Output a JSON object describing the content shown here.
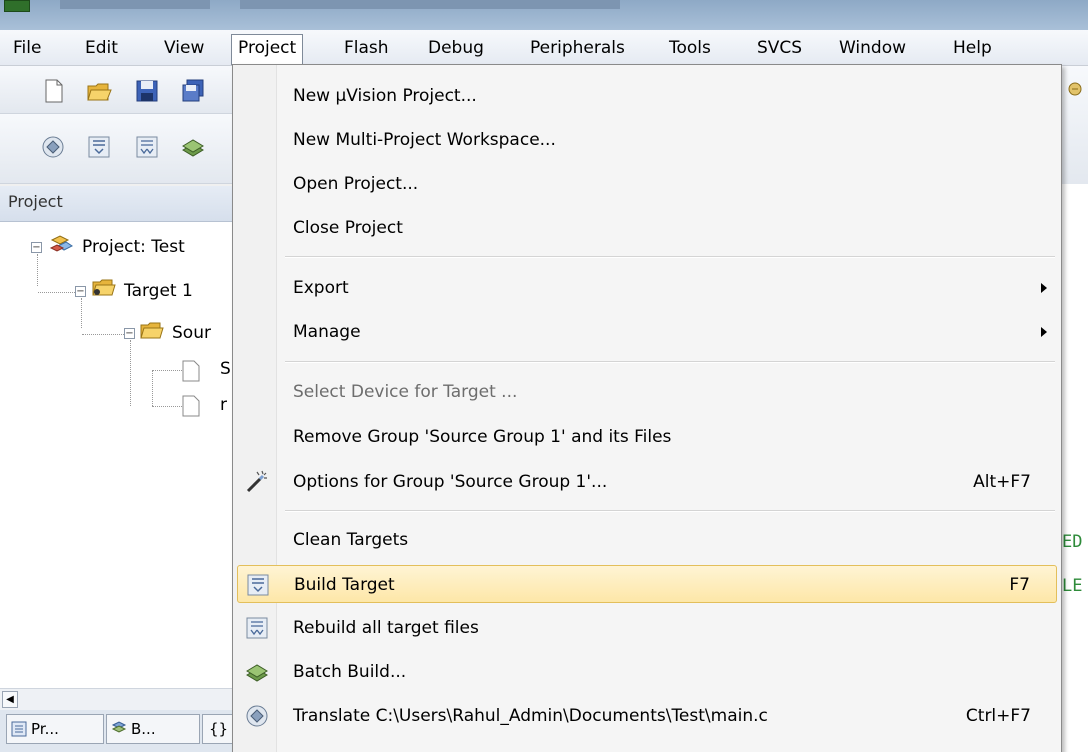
{
  "menubar": {
    "items": [
      {
        "label": "File"
      },
      {
        "label": "Edit"
      },
      {
        "label": "View"
      },
      {
        "label": "Project"
      },
      {
        "label": "Flash"
      },
      {
        "label": "Debug"
      },
      {
        "label": "Peripherals"
      },
      {
        "label": "Tools"
      },
      {
        "label": "SVCS"
      },
      {
        "label": "Window"
      },
      {
        "label": "Help"
      }
    ],
    "active": "Project"
  },
  "project_panel": {
    "title": "Project",
    "tree": {
      "project": "Project: Test",
      "target": "Target 1",
      "group": "Sour",
      "file1": "S",
      "file2": "r"
    }
  },
  "bottom_tabs": [
    {
      "label": "Pr...",
      "icon": "project-tab-icon"
    },
    {
      "label": "B...",
      "icon": "books-tab-icon"
    },
    {
      "label": "{}",
      "icon": "functions-tab-icon"
    }
  ],
  "editor": {
    "line1": "ED",
    "line2": "LE"
  },
  "project_menu": {
    "groups": [
      [
        {
          "label": "New µVision Project...",
          "enabled": true
        },
        {
          "label": "New Multi-Project Workspace...",
          "enabled": true
        },
        {
          "label": "Open Project...",
          "enabled": true
        },
        {
          "label": "Close Project",
          "enabled": true
        }
      ],
      [
        {
          "label": "Export",
          "submenu": true
        },
        {
          "label": "Manage",
          "submenu": true
        }
      ],
      [
        {
          "label": "Select Device for Target ...",
          "enabled": false
        },
        {
          "label": "Remove Group 'Source Group 1' and its Files",
          "enabled": true
        },
        {
          "label": "Options for Group 'Source Group 1'...",
          "shortcut": "Alt+F7",
          "icon": "magic-wand-icon"
        }
      ],
      [
        {
          "label": "Clean Targets"
        },
        {
          "label": "Build Target",
          "shortcut": "F7",
          "icon": "build-icon",
          "highlighted": true
        },
        {
          "label": "Rebuild all target files",
          "icon": "rebuild-icon"
        },
        {
          "label": "Batch Build...",
          "icon": "batch-build-icon"
        },
        {
          "label": "Translate C:\\Users\\Rahul_Admin\\Documents\\Test\\main.c",
          "shortcut": "Ctrl+F7",
          "icon": "translate-icon"
        }
      ]
    ]
  },
  "colors": {
    "highlight_bg": "#fde7a8",
    "highlight_border": "#e3bf5b",
    "menu_bg": "#f5f5f5",
    "code_green": "#2e8b3a"
  }
}
